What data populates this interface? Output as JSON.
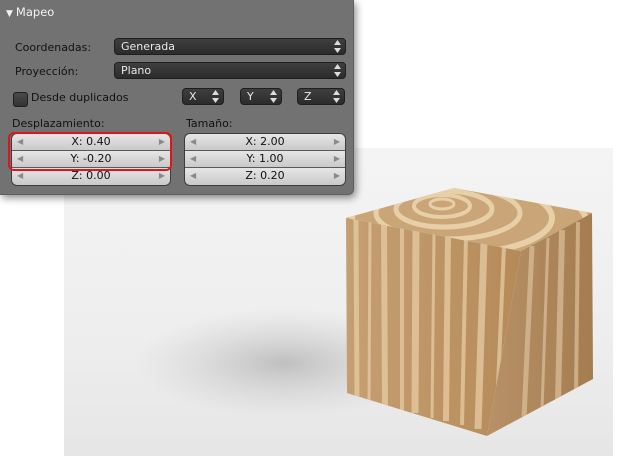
{
  "panel": {
    "title": "Mapeo",
    "collapse_icon": "triangle-down",
    "coordinates": {
      "label": "Coordenadas:",
      "value": "Generada"
    },
    "projection": {
      "label": "Proyección:",
      "value": "Plano"
    },
    "from_dupli": {
      "label": "Desde duplicados",
      "checked": false
    },
    "axes": [
      "X",
      "Y",
      "Z"
    ],
    "offset": {
      "label": "Desplazamiento:",
      "x": "X: 0.40",
      "y": "Y: -0.20",
      "z": "Z: 0.00"
    },
    "size": {
      "label": "Tamaño:",
      "x": "X: 2.00",
      "y": "Y: 1.00",
      "z": "Z: 0.20"
    }
  },
  "colors": {
    "panel_bg": "#727272",
    "highlight": "#e0141a",
    "wood_light": "#e2c69c",
    "wood_dark": "#b58a59"
  }
}
